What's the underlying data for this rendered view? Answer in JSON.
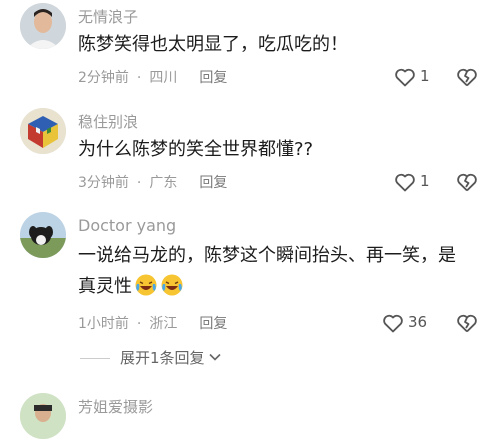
{
  "comments": [
    {
      "username": "无情浪子",
      "text": "陈梦笑得也太明显了，吃瓜吃的！",
      "time": "2分钟前",
      "location": "四川",
      "reply_label": "回复",
      "likes": "1"
    },
    {
      "username": "稳住别浪",
      "text": "为什么陈梦的笑全世界都懂??",
      "time": "3分钟前",
      "location": "广东",
      "reply_label": "回复",
      "likes": "1"
    },
    {
      "username": "Doctor  yang",
      "text_line1": "一说给马龙的，陈梦这个瞬间抬头、再一笑，是",
      "text_line2": "真灵性",
      "time": "1小时前",
      "location": "浙江",
      "reply_label": "回复",
      "likes": "36",
      "emojis": [
        "laughing-crying-emoji",
        "laughing-crying-emoji"
      ]
    },
    {
      "username": "芳姐爱摄影"
    }
  ],
  "expand_replies": {
    "label": "展开1条回复",
    "icon": "chevron-down-icon"
  },
  "colors": {
    "meta_gray": "#9a9a9a",
    "text": "#1c1c1c",
    "icon": "#555555"
  }
}
